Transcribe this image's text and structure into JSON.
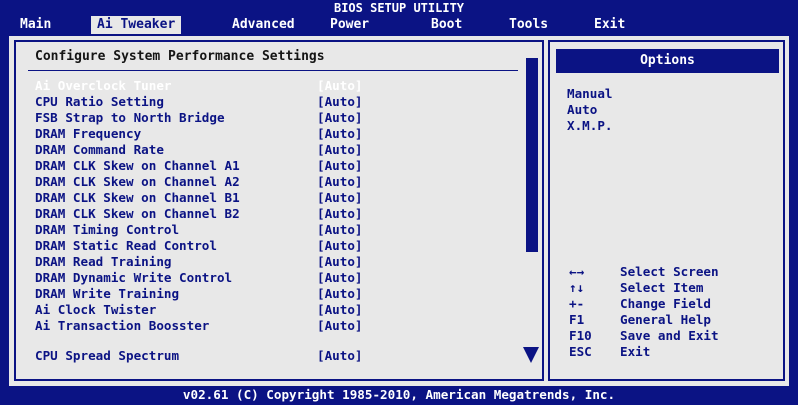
{
  "window": {
    "title": "BIOS SETUP UTILITY"
  },
  "menu": [
    {
      "label": "Main"
    },
    {
      "label": "Ai Tweaker"
    },
    {
      "label": "Advanced"
    },
    {
      "label": "Power"
    },
    {
      "label": "Boot"
    },
    {
      "label": "Tools"
    },
    {
      "label": "Exit"
    }
  ],
  "main": {
    "section_title": "Configure System Performance Settings",
    "settings": [
      {
        "label": "Ai Overclock Tuner",
        "value": "[Auto]"
      },
      {
        "label": "CPU Ratio Setting",
        "value": "[Auto]"
      },
      {
        "label": "FSB Strap to North Bridge",
        "value": "[Auto]"
      },
      {
        "label": "DRAM Frequency",
        "value": "[Auto]"
      },
      {
        "label": "DRAM Command Rate",
        "value": "[Auto]"
      },
      {
        "label": "DRAM CLK Skew on Channel A1",
        "value": "[Auto]"
      },
      {
        "label": "DRAM CLK Skew on Channel A2",
        "value": "[Auto]"
      },
      {
        "label": "DRAM CLK Skew on Channel B1",
        "value": "[Auto]"
      },
      {
        "label": "DRAM CLK Skew on Channel B2",
        "value": "[Auto]"
      },
      {
        "label": "DRAM Timing Control",
        "value": "[Auto]"
      },
      {
        "label": "DRAM Static Read Control",
        "value": "[Auto]"
      },
      {
        "label": "DRAM Read Training",
        "value": "[Auto]"
      },
      {
        "label": "DRAM Dynamic Write Control",
        "value": "[Auto]"
      },
      {
        "label": "DRAM Write Training",
        "value": "[Auto]"
      },
      {
        "label": "Ai Clock Twister",
        "value": "[Auto]"
      },
      {
        "label": "Ai Transaction Boosster",
        "value": "[Auto]"
      },
      {
        "label": "CPU Spread Spectrum",
        "value": "[Auto]"
      }
    ]
  },
  "options": {
    "header": "Options",
    "items": [
      "Manual",
      "Auto",
      "X.M.P."
    ]
  },
  "help": [
    {
      "key": "←→",
      "desc": "Select Screen"
    },
    {
      "key": "↑↓",
      "desc": "Select Item"
    },
    {
      "key": "+-",
      "desc": "Change Field"
    },
    {
      "key": "F1",
      "desc": "General Help"
    },
    {
      "key": "F10",
      "desc": "Save and Exit"
    },
    {
      "key": "ESC",
      "desc": "Exit"
    }
  ],
  "footer": "v02.61 (C) Copyright 1985-2010, American Megatrends, Inc."
}
